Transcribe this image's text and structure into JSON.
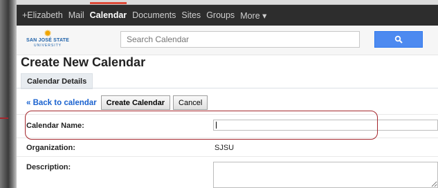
{
  "nav": {
    "items": [
      "+Elizabeth",
      "Mail",
      "Calendar",
      "Documents",
      "Sites",
      "Groups",
      "More ▾"
    ],
    "active_index": 2
  },
  "logo": {
    "name": "SAN JOSÉ STATE",
    "sub": "UNIVERSITY"
  },
  "search": {
    "placeholder": "Search Calendar"
  },
  "page": {
    "title": "Create New Calendar",
    "tab": "Calendar Details",
    "back_link": "« Back to calendar",
    "create_button": "Create Calendar",
    "cancel_button": "Cancel"
  },
  "form": {
    "calendar_name_label": "Calendar Name:",
    "calendar_name_value": "",
    "organization_label": "Organization:",
    "organization_value": "SJSU",
    "description_label": "Description:"
  },
  "colors": {
    "topbar": "#2d2d2d",
    "accent_red": "#dd4b39",
    "search_blue": "#4d8af0",
    "highlight": "#a4262c",
    "link": "#1a62cf"
  }
}
